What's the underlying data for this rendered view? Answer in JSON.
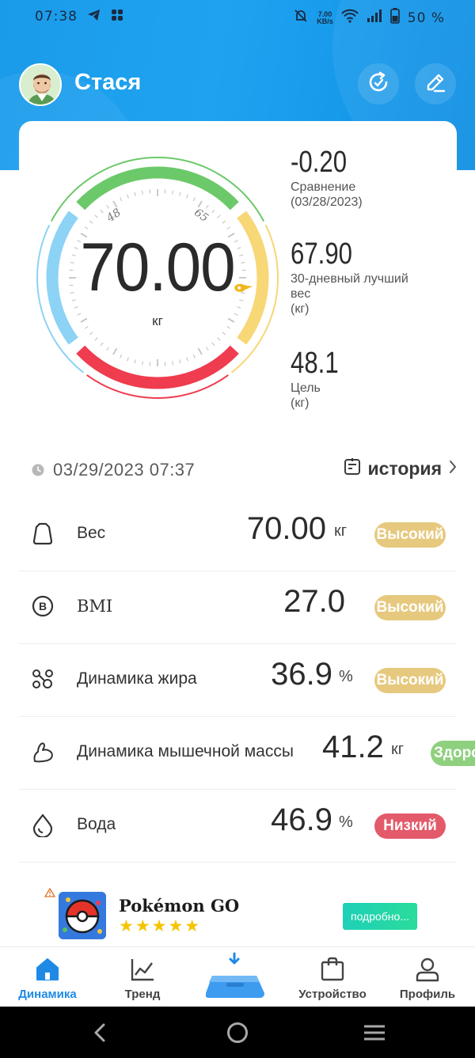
{
  "status_bar": {
    "time": "07:38",
    "speed_value": "7.00",
    "speed_unit": "KB/s",
    "battery": "50 %"
  },
  "header": {
    "user_name": "Стася",
    "avatar_icon": "avatar-man-beard",
    "sync_icon": "refresh-icon",
    "edit_icon": "pencil-icon"
  },
  "gauge": {
    "value": "70.00",
    "unit": "кг",
    "tick_low": "48",
    "tick_high": "65"
  },
  "stats": [
    {
      "value": "-0.20",
      "label_lines": [
        "Сравнение",
        "(03/28/2023)"
      ]
    },
    {
      "value": "67.90",
      "label_lines": [
        "30-дневный лучший",
        "вес",
        "(кг)"
      ]
    },
    {
      "value": "48.1",
      "label_lines": [
        "Цель",
        "(кг)"
      ]
    }
  ],
  "measurement": {
    "datetime": "03/29/2023 07:37",
    "history_label": "история"
  },
  "metrics": [
    {
      "name": "Вес",
      "value": "70.00",
      "unit": "кг",
      "status": "Высокий",
      "icon": "weight-bag-icon"
    },
    {
      "name": "BMI",
      "value": "27.0",
      "unit": "",
      "status": "Высокий",
      "icon": "bmi-icon"
    },
    {
      "name": "Динамика жира",
      "value": "36.9",
      "unit": "%",
      "status": "Высокий",
      "icon": "fat-icon"
    },
    {
      "name": "Динамика мышечной массы",
      "value": "41.2",
      "unit": "кг",
      "status": "Здоро",
      "icon": "muscle-icon"
    },
    {
      "name": "Вода",
      "value": "46.9",
      "unit": "%",
      "status": "Низкий",
      "icon": "water-drop-icon"
    }
  ],
  "ad": {
    "title": "Pokémon GO",
    "rating_stars": "★★★★★",
    "button_label": "подробно..."
  },
  "bottom_nav": {
    "items": [
      {
        "label": "Динамика",
        "active": true
      },
      {
        "label": "Тренд",
        "active": false
      },
      {
        "label": "",
        "active": false
      },
      {
        "label": "Устройство",
        "active": false
      },
      {
        "label": "Профиль",
        "active": false
      }
    ]
  },
  "colors": {
    "header_blue": "#1a9bea",
    "nav_active": "#1e8ae6",
    "badge_high": "#e6c97e",
    "badge_healthy": "#8fd07e",
    "badge_low": "#e35a6a",
    "gauge_green": "#6cc96a",
    "gauge_yellow": "#f7d776",
    "gauge_red": "#ef3c4e",
    "gauge_blue": "#8cd3f5"
  }
}
